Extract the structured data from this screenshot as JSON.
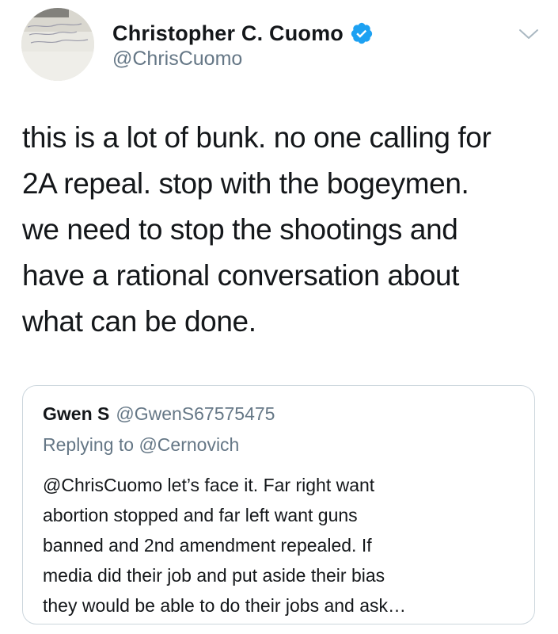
{
  "author": {
    "display_name": "Christopher C. Cuomo",
    "handle": "@ChrisCuomo",
    "verified": true,
    "verified_icon": "verified-badge-icon",
    "menu_icon": "chevron-down-icon"
  },
  "tweet": {
    "text": "this is a lot of bunk. no one calling for\n2A repeal. stop with the bogeymen.\nwe need to stop the shootings and\nhave a rational conversation about\nwhat can be done."
  },
  "quoted_tweet": {
    "display_name": "Gwen S",
    "handle": "@GwenS67575475",
    "replying_to": "Replying to @Cernovich",
    "text": "@ChrisCuomo let’s face it. Far right want\nabortion stopped and far left want guns\nbanned and 2nd amendment repealed. If\nmedia did their job and put aside their bias\nthey would be able to do their jobs and ask…"
  },
  "colors": {
    "text_primary": "#14171a",
    "text_secondary": "#657786",
    "verified_blue": "#1da1f2",
    "border": "#ccd6dd"
  }
}
